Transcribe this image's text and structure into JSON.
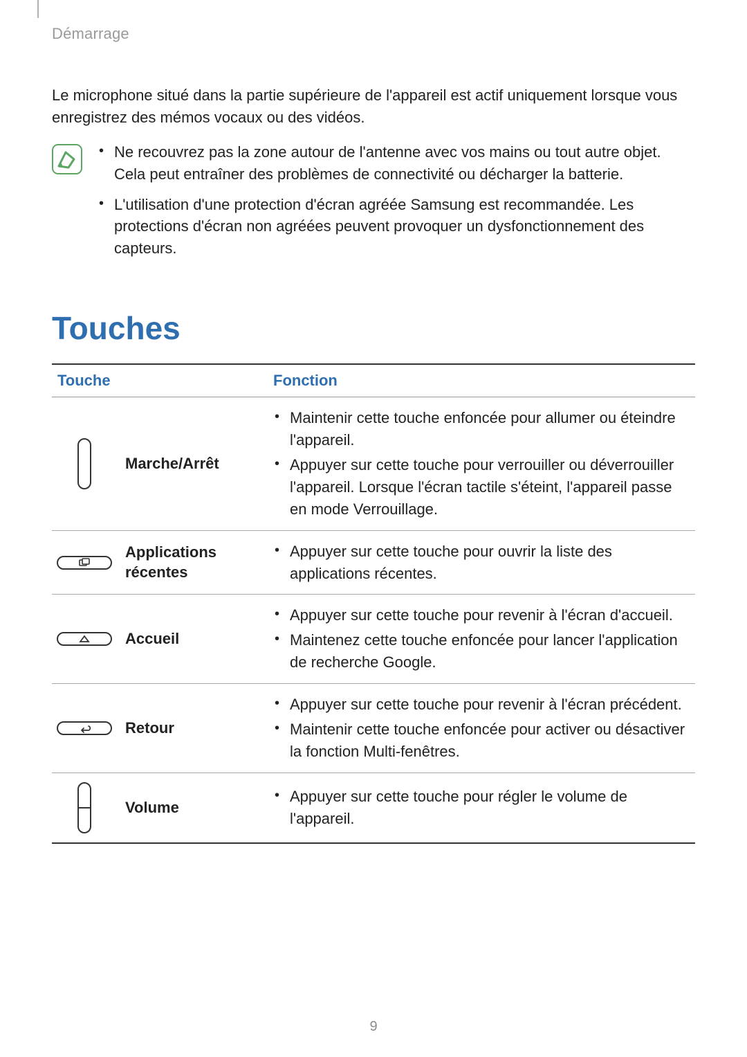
{
  "breadcrumb": "Démarrage",
  "intro_paragraph": "Le microphone situé dans la partie supérieure de l'appareil est actif uniquement lorsque vous enregistrez des mémos vocaux ou des vidéos.",
  "note_bullets": [
    "Ne recouvrez pas la zone autour de l'antenne avec vos mains ou tout autre objet. Cela peut entraîner des problèmes de connectivité ou décharger la batterie.",
    "L'utilisation d'une protection d'écran agréée Samsung est recommandée. Les protections d'écran non agréées peuvent provoquer un dysfonctionnement des capteurs."
  ],
  "section_title": "Touches",
  "table": {
    "headers": {
      "col1": "Touche",
      "col2": "Fonction"
    },
    "rows": [
      {
        "name": "Marche/Arrêt",
        "icon": "power-button-icon",
        "functions": [
          "Maintenir cette touche enfoncée pour allumer ou éteindre l'appareil.",
          "Appuyer sur cette touche pour verrouiller ou déverrouiller l'appareil. Lorsque l'écran tactile s'éteint, l'appareil passe en mode Verrouillage."
        ]
      },
      {
        "name": "Applications récentes",
        "icon": "recent-apps-icon",
        "functions": [
          "Appuyer sur cette touche pour ouvrir la liste des applications récentes."
        ]
      },
      {
        "name": "Accueil",
        "icon": "home-icon",
        "functions": [
          "Appuyer sur cette touche pour revenir à l'écran d'accueil.",
          "Maintenez cette touche enfoncée pour lancer l'application de recherche Google."
        ]
      },
      {
        "name": "Retour",
        "icon": "back-icon",
        "functions": [
          "Appuyer sur cette touche pour revenir à l'écran précédent.",
          "Maintenir cette touche enfoncée pour activer ou désactiver la fonction Multi-fenêtres."
        ]
      },
      {
        "name": "Volume",
        "icon": "volume-rocker-icon",
        "functions": [
          "Appuyer sur cette touche pour régler le volume de l'appareil."
        ]
      }
    ]
  },
  "page_number": "9"
}
